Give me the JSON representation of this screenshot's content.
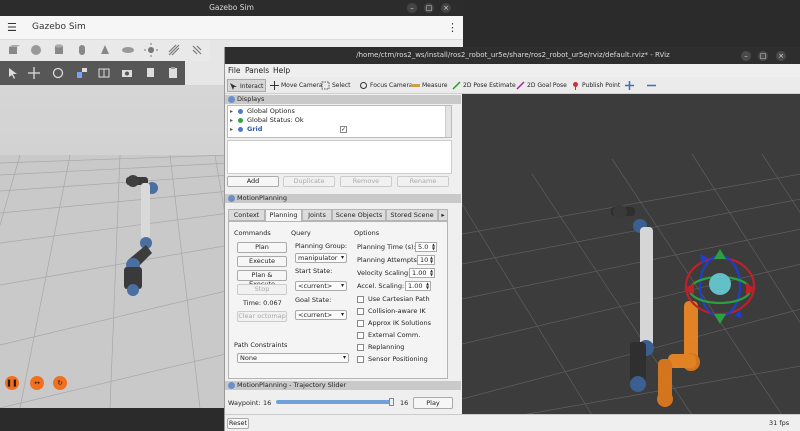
{
  "gazebo": {
    "window_title": "Gazebo Sim",
    "app_title": "Gazebo Sim",
    "menu_icon": "hamburger-menu-icon",
    "kebab_icon": "kebab-menu-icon",
    "toolbar_shapes": [
      "box-icon",
      "sphere-icon",
      "cylinder-icon",
      "capsule-icon",
      "ellipsoid-icon",
      "sun-icon",
      "directional-light-icon",
      "spot-light-icon"
    ],
    "toolbar_transform": [
      "select-arrow-icon",
      "translate-icon",
      "rotate-icon",
      "snap-icon",
      "grid-icon",
      "screenshot-icon",
      "copy-icon",
      "paste-icon"
    ],
    "sim_controls": [
      "pause-icon",
      "step-icon",
      "reset-icon"
    ]
  },
  "rviz": {
    "window_title": "/home/ctm/ros2_ws/install/ros2_robot_ur5e/share/ros2_robot_ur5e/rviz/default.rviz* - RViz",
    "menu": [
      "File",
      "Panels",
      "Help"
    ],
    "tools": [
      {
        "label": "Interact",
        "icon": "interact-icon"
      },
      {
        "label": "Move Camera",
        "icon": "move-camera-icon"
      },
      {
        "label": "Select",
        "icon": "select-icon"
      },
      {
        "label": "Focus Camera",
        "icon": "focus-camera-icon"
      },
      {
        "label": "Measure",
        "icon": "measure-icon"
      },
      {
        "label": "2D Pose Estimate",
        "icon": "pose-estimate-icon"
      },
      {
        "label": "2D Goal Pose",
        "icon": "goal-pose-icon"
      },
      {
        "label": "Publish Point",
        "icon": "publish-point-icon"
      }
    ],
    "displays": {
      "title": "Displays",
      "items": [
        {
          "label": "Global Options"
        },
        {
          "label": "Global Status: Ok"
        },
        {
          "label": "Grid"
        }
      ],
      "buttons": [
        "Add",
        "Duplicate",
        "Remove",
        "Rename"
      ]
    },
    "motion_planning": {
      "title": "MotionPlanning",
      "tabs": [
        "Context",
        "Planning",
        "Joints",
        "Scene Objects",
        "Stored Scene"
      ],
      "commands_header": "Commands",
      "query_header": "Query",
      "options_header": "Options",
      "commands": [
        "Plan",
        "Execute",
        "Plan & Execute",
        "Stop"
      ],
      "time_label": "Time: 0.067",
      "clear_octomap": "Clear octomap",
      "planning_group_label": "Planning Group:",
      "planning_group_value": "manipulator",
      "start_state_label": "Start State:",
      "start_state_value": "<current>",
      "goal_state_label": "Goal State:",
      "goal_state_value": "<current>",
      "planning_time_label": "Planning Time (s):",
      "planning_time_value": "5.0",
      "planning_attempts_label": "Planning Attempts:",
      "planning_attempts_value": "10",
      "velocity_scaling_label": "Velocity Scaling:",
      "velocity_scaling_value": "1.00",
      "accel_scaling_label": "Accel. Scaling:",
      "accel_scaling_value": "1.00",
      "checkboxes": [
        "Use Cartesian Path",
        "Collision-aware IK",
        "Approx IK Solutions",
        "External Comm.",
        "Replanning",
        "Sensor Positioning"
      ],
      "path_constraints_label": "Path Constraints",
      "path_constraints_value": "None"
    },
    "trajectory": {
      "title": "MotionPlanning - Trajectory Slider",
      "waypoint_label": "Waypoint:",
      "waypoint_value": "16",
      "waypoint_max": "16",
      "play_label": "Play"
    },
    "status": {
      "reset_label": "Reset",
      "fps": "31 fps"
    }
  }
}
